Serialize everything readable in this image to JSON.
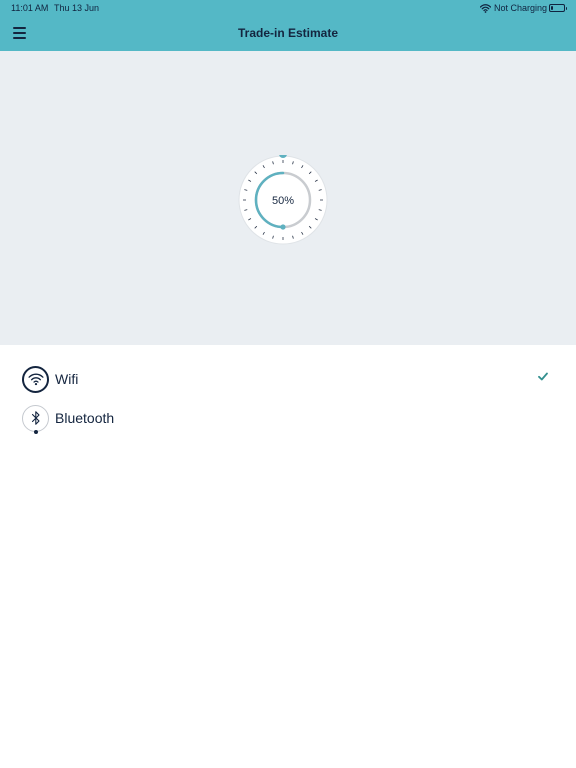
{
  "status_bar": {
    "time": "11:01 AM",
    "date": "Thu 13 Jun",
    "charging": "Not Charging",
    "wifi_icon": "wifi-icon",
    "battery_level": 0.1
  },
  "header": {
    "title": "Trade-in Estimate",
    "menu_icon": "hamburger-menu-icon"
  },
  "gauge": {
    "progress": 0.5,
    "label": "50%"
  },
  "options": [
    {
      "label": "Wifi",
      "icon": "wifi-icon",
      "selected": true
    },
    {
      "label": "Bluetooth",
      "icon": "bluetooth-icon",
      "selected": false
    }
  ],
  "colors": {
    "header": "#54b8c6",
    "accent": "#5fb1c0",
    "text": "#14253f",
    "panel": "#eaeef2",
    "check": "#34908f"
  }
}
